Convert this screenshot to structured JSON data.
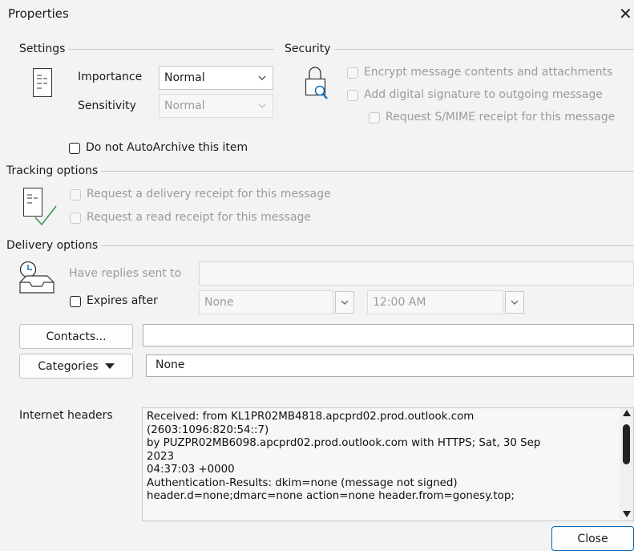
{
  "window": {
    "title": "Properties",
    "close_glyph": "✕"
  },
  "settings": {
    "group_label": "Settings",
    "importance_label": "Importance",
    "importance_value": "Normal",
    "sensitivity_label": "Sensitivity",
    "sensitivity_value": "Normal",
    "icon": "settings-list-icon"
  },
  "security": {
    "group_label": "Security",
    "icon": "lock-search-icon",
    "encrypt_label": "Encrypt message contents and attachments",
    "signature_label": "Add digital signature to outgoing message",
    "smime_label": "Request S/MIME receipt for this message"
  },
  "autoarchive": {
    "label": "Do not AutoArchive this item"
  },
  "tracking": {
    "group_label": "Tracking options",
    "icon": "tracking-checklist-icon",
    "delivery_receipt_label": "Request a delivery receipt for this message",
    "read_receipt_label": "Request a read receipt for this message"
  },
  "delivery": {
    "group_label": "Delivery options",
    "icon": "clock-inbox-icon",
    "replies_label": "Have replies sent to",
    "replies_value": "",
    "expires_label": "Expires after",
    "expires_date": "None",
    "expires_time": "12:00 AM"
  },
  "contacts": {
    "button_label": "Contacts...",
    "value": ""
  },
  "categories": {
    "button_label": "Categories",
    "value": "None"
  },
  "internet_headers": {
    "label": "Internet headers",
    "lines": [
      "Received: from KL1PR02MB4818.apcprd02.prod.outlook.com",
      "(2603:1096:820:54::7)",
      " by PUZPR02MB6098.apcprd02.prod.outlook.com with HTTPS; Sat, 30 Sep",
      "2023",
      " 04:37:03 +0000",
      "Authentication-Results: dkim=none (message not signed)",
      " header.d=none;dmarc=none action=none header.from=gonesy.top;"
    ]
  },
  "footer": {
    "close_label": "Close"
  },
  "colors": {
    "accent": "#0067c0",
    "disabled_text": "#9b9b9b",
    "background": "#f3f3f3"
  }
}
